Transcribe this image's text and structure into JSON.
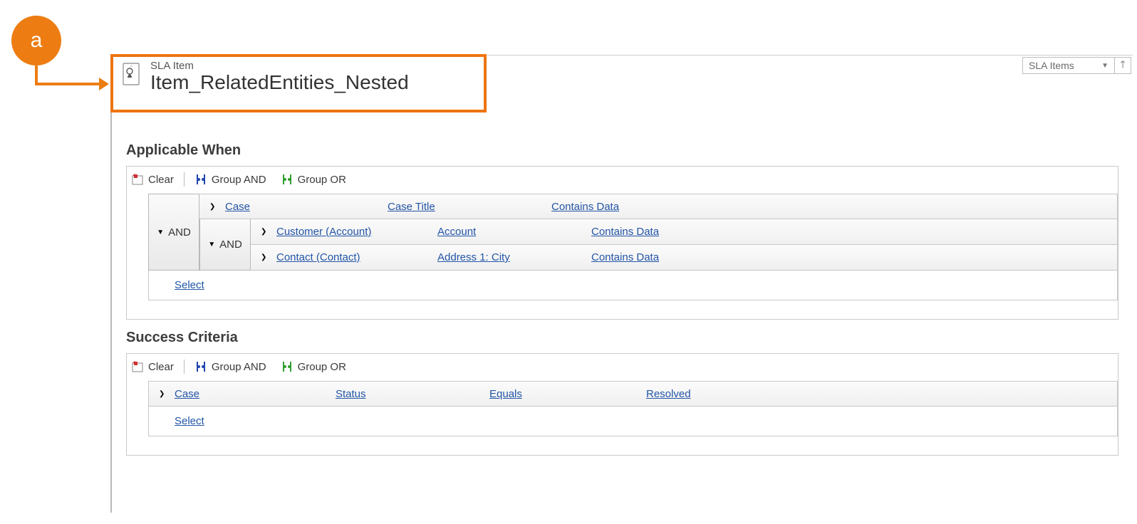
{
  "callout": {
    "letter": "a"
  },
  "header": {
    "entity_label": "SLA Item",
    "title": "Item_RelatedEntities_Nested"
  },
  "view_selector": {
    "label": "SLA Items"
  },
  "toolbar": {
    "clear": "Clear",
    "group_and": "Group AND",
    "group_or": "Group OR"
  },
  "logic": {
    "and": "AND"
  },
  "actions": {
    "select": "Select"
  },
  "sections": {
    "applicable_when": {
      "title": "Applicable When",
      "rows": [
        {
          "entity": "Case",
          "field": "Case Title",
          "operator": "Contains Data"
        },
        {
          "entity": "Customer (Account)",
          "field": "Account",
          "operator": "Contains Data"
        },
        {
          "entity": "Contact (Contact)",
          "field": "Address 1: City",
          "operator": "Contains Data"
        }
      ]
    },
    "success_criteria": {
      "title": "Success Criteria",
      "rows": [
        {
          "entity": "Case",
          "field": "Status",
          "operator": "Equals",
          "value": "Resolved"
        }
      ]
    }
  }
}
